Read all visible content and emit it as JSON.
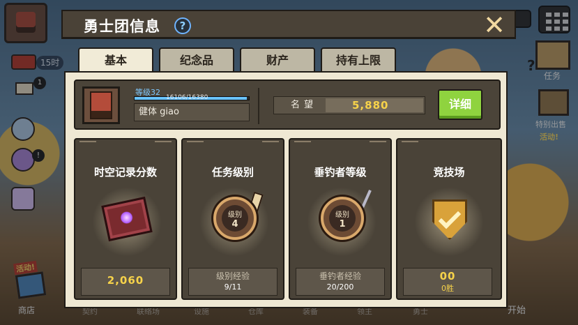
{
  "background_hud": {
    "time_label": "15时",
    "badge_count": "1",
    "excl_mark": "!",
    "shop_event_label": "活动!",
    "shop_label": "商店",
    "task_label": "任务",
    "special_label": "特别出售",
    "special_event": "活动!",
    "start_label": "开始",
    "bottom_faint_labels": [
      "契约",
      "联络场",
      "设施",
      "仓库",
      "装备",
      "领主",
      "勇士"
    ]
  },
  "modal": {
    "title": "勇士团信息",
    "help_symbol": "?",
    "close_symbol": "✕",
    "tabs": [
      {
        "label": "基本",
        "active": true
      },
      {
        "label": "纪念品",
        "active": false
      },
      {
        "label": "财产",
        "active": false
      },
      {
        "label": "持有上限",
        "active": false
      }
    ],
    "profile": {
      "level_text": "等级32",
      "exp_text": "16106/16380",
      "exp_fraction": 0.983,
      "name": "健体 giao",
      "reputation_label": "名望",
      "reputation_value": "5,880",
      "detail_button": "详细"
    },
    "cards": [
      {
        "title": "时空记录分数",
        "value": "2,060",
        "icon": "record-book-icon"
      },
      {
        "title": "任务级别",
        "medal_label": "级别",
        "medal_level": "4",
        "sub_label": "级别经验",
        "sub_value": "9/11",
        "icon": "task-medal-icon"
      },
      {
        "title": "垂钓者等级",
        "medal_label": "级别",
        "medal_level": "1",
        "sub_label": "垂钓者经验",
        "sub_value": "20/200",
        "icon": "angler-medal-icon"
      },
      {
        "title": "竞技场",
        "value": "00",
        "sub_value": "0胜",
        "icon": "arena-shield-icon"
      }
    ]
  },
  "colors": {
    "header": "#4a4237",
    "body": "#efe8d3",
    "card": "#4a4338",
    "accent_green": "#8fd33f",
    "value_gold": "#f7d34a",
    "level_blue": "#7ec8ff"
  }
}
